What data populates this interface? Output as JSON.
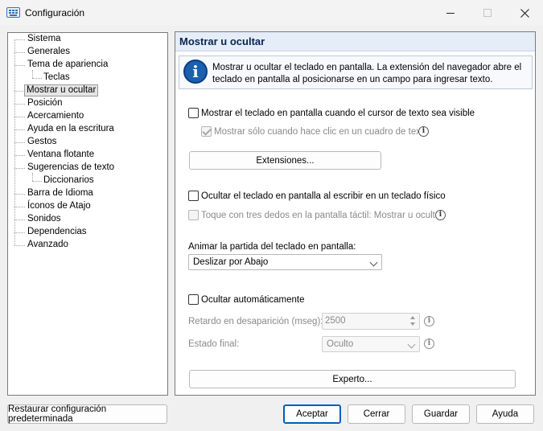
{
  "window": {
    "title": "Configuración"
  },
  "tree": {
    "items": [
      {
        "label": "Sistema"
      },
      {
        "label": "Generales"
      },
      {
        "label": "Tema de apariencia"
      },
      {
        "label": "Teclas"
      },
      {
        "label": "Mostrar u ocultar"
      },
      {
        "label": "Posición"
      },
      {
        "label": "Acercamiento"
      },
      {
        "label": "Ayuda en la escritura"
      },
      {
        "label": "Gestos"
      },
      {
        "label": "Ventana flotante"
      },
      {
        "label": "Sugerencias de texto"
      },
      {
        "label": "Diccionarios"
      },
      {
        "label": "Barra de Idioma"
      },
      {
        "label": "Íconos de Atajo"
      },
      {
        "label": "Sonidos"
      },
      {
        "label": "Dependencias"
      },
      {
        "label": "Avanzado"
      }
    ],
    "selected": "Mostrar u ocultar"
  },
  "panel": {
    "title": "Mostrar u ocultar",
    "info_line1": "Mostrar u ocultar el teclado en pantalla. La extensión del navegador abre el",
    "info_line2": "teclado en pantalla al posicionarse en un campo para ingresar texto.",
    "show_when_cursor": {
      "label": "Mostrar el teclado en pantalla cuando el cursor de texto sea visible",
      "checked": false
    },
    "show_only_on_click": {
      "label": "Mostrar sólo cuando hace clic en un cuadro de texto",
      "checked": true,
      "disabled": true
    },
    "extensions_button": "Extensiones...",
    "hide_physical": {
      "label": "Ocultar el teclado en pantalla al escribir en un teclado físico",
      "checked": false
    },
    "three_finger": {
      "label": "Toque con tres dedos en la pantalla táctil: Mostrar u ocultar",
      "checked": false,
      "disabled": true
    },
    "animate_label": "Animar la partida del teclado en pantalla:",
    "animate_value": "Deslizar por Abajo",
    "auto_hide": {
      "label": "Ocultar automáticamente",
      "checked": false
    },
    "delay_label": "Retardo en desaparición (mseg):",
    "delay_value": "2500",
    "final_state_label": "Estado final:",
    "final_state_value": "Oculto",
    "expert_button": "Experto..."
  },
  "footer": {
    "restore": "Restaurar configuración predeterminada",
    "accept": "Aceptar",
    "close": "Cerrar",
    "save": "Guardar",
    "help": "Ayuda"
  },
  "colors": {
    "accent": "#005fb8",
    "panel_header": "#e4edf8",
    "info_icon": "#1b5fae"
  }
}
